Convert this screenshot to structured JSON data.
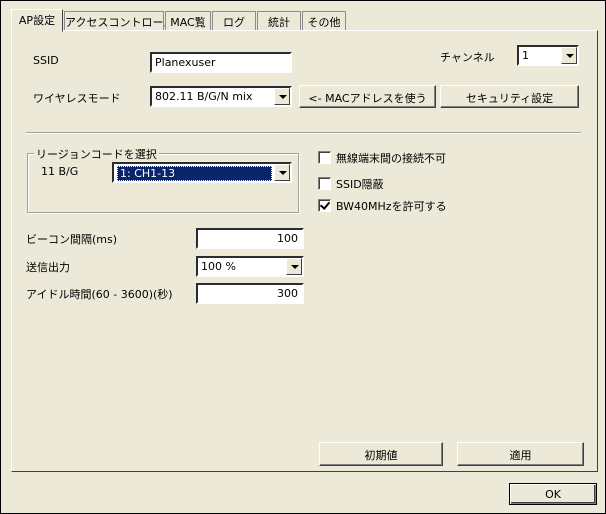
{
  "tabs": [
    {
      "label": "AP設定",
      "active": true
    },
    {
      "label": "アクセスコントロール",
      "active": false
    },
    {
      "label": "MAC覧",
      "active": false
    },
    {
      "label": "ログ",
      "active": false
    },
    {
      "label": "統計",
      "active": false
    },
    {
      "label": "その他",
      "active": false
    }
  ],
  "ssid": {
    "label": "SSID",
    "value": "Planexuser"
  },
  "channel": {
    "label": "チャンネル",
    "value": "1"
  },
  "wireless_mode": {
    "label": "ワイヤレスモード",
    "value": "802.11 B/G/N mix"
  },
  "buttons": {
    "use_mac": "<- MACアドレスを使う",
    "security": "セキュリティ設定",
    "defaults": "初期値",
    "apply": "適用",
    "ok": "OK"
  },
  "region": {
    "group_title": "リージョンコードを選択",
    "label": "11 B/G",
    "value": "1: CH1-13"
  },
  "options": {
    "isolation": {
      "label": "無線端末間の接続不可",
      "checked": false
    },
    "ssid_hidden": {
      "label": "SSID隠蔽",
      "checked": false
    },
    "bw40": {
      "label": "BW40MHzを許可する",
      "checked": true
    }
  },
  "beacon": {
    "label": "ビーコン間隔(ms)",
    "value": "100"
  },
  "tx_power": {
    "label": "送信出力",
    "value": "100 %"
  },
  "idle_time": {
    "label": "アイドル時間(60 - 3600)(秒)",
    "value": "300"
  }
}
